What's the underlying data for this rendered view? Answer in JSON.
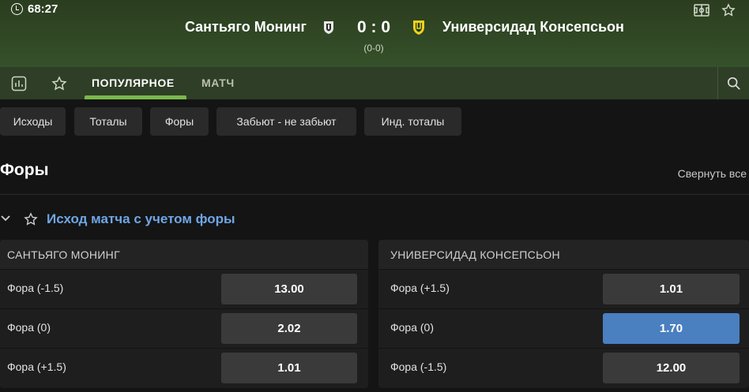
{
  "header": {
    "time": "68:27",
    "home_team": "Сантьяго Монинг",
    "away_team": "Универсидад Консепсьон",
    "score": "0 : 0",
    "half_score": "(0-0)",
    "icons": [
      "field-icon",
      "star-icon"
    ]
  },
  "tabs": {
    "items": [
      {
        "label": "ПОПУЛЯРНОЕ",
        "active": true
      },
      {
        "label": "МАТЧ",
        "active": false
      }
    ],
    "icons": [
      "stats-icon",
      "favorite-icon",
      "search-icon"
    ]
  },
  "filters": [
    "Исходы",
    "Тоталы",
    "Форы",
    "Забьют - не забьют",
    "Инд. тоталы"
  ],
  "section": {
    "title": "Форы",
    "collapse_label": "Свернуть все"
  },
  "market": {
    "title": "Исход матча с учетом форы",
    "panels": [
      {
        "header": "САНТЬЯГО МОНИНГ",
        "rows": [
          {
            "label": "Фора (-1.5)",
            "odds": "13.00",
            "selected": false
          },
          {
            "label": "Фора (0)",
            "odds": "2.02",
            "selected": false
          },
          {
            "label": "Фора (+1.5)",
            "odds": "1.01",
            "selected": false
          }
        ]
      },
      {
        "header": "УНИВЕРСИДАД КОНСЕПСЬОН",
        "rows": [
          {
            "label": "Фора (+1.5)",
            "odds": "1.01",
            "selected": false
          },
          {
            "label": "Фора (0)",
            "odds": "1.70",
            "selected": true
          },
          {
            "label": "Фора (-1.5)",
            "odds": "12.00",
            "selected": false
          }
        ]
      }
    ]
  },
  "colors": {
    "header_bg": "#35512a",
    "tab_accent": "#79b84a",
    "market_title": "#6fa6e6",
    "selected_odd": "#4a7fc0"
  }
}
